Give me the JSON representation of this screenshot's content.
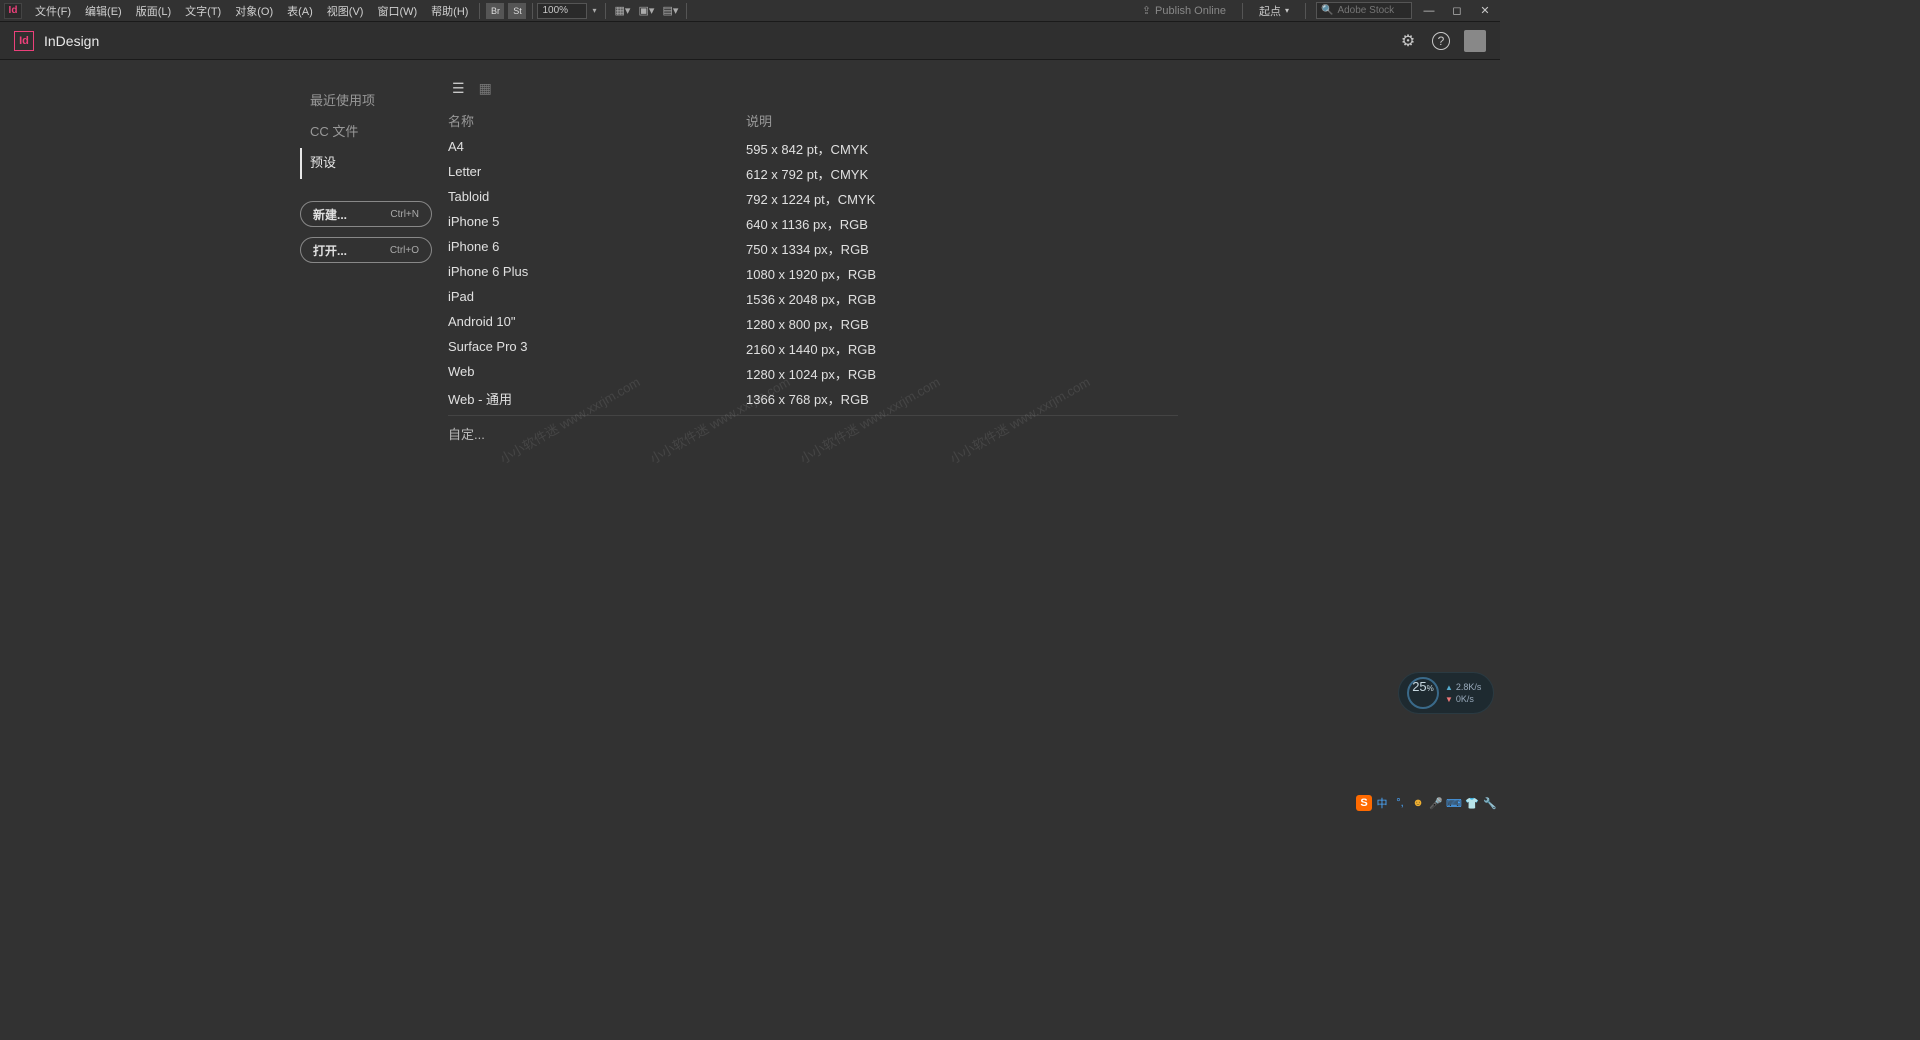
{
  "menubar": {
    "items": [
      "文件(F)",
      "编辑(E)",
      "版面(L)",
      "文字(T)",
      "对象(O)",
      "表(A)",
      "视图(V)",
      "窗口(W)",
      "帮助(H)"
    ],
    "br": "Br",
    "st": "St",
    "zoom": "100%",
    "publish": "Publish Online",
    "origin": "起点",
    "stock_placeholder": "Adobe Stock"
  },
  "titlebar": {
    "logo": "Id",
    "title": "InDesign"
  },
  "sidebar": {
    "tabs": [
      "最近使用项",
      "CC 文件",
      "预设"
    ],
    "active_index": 2,
    "buttons": [
      {
        "label": "新建...",
        "shortcut": "Ctrl+N"
      },
      {
        "label": "打开...",
        "shortcut": "Ctrl+O"
      }
    ]
  },
  "presets": {
    "header_name": "名称",
    "header_desc": "说明",
    "rows": [
      {
        "name": "A4",
        "desc": "595 x 842 pt，CMYK"
      },
      {
        "name": "Letter",
        "desc": "612 x 792 pt，CMYK"
      },
      {
        "name": "Tabloid",
        "desc": "792 x 1224 pt，CMYK"
      },
      {
        "name": "iPhone 5",
        "desc": "640 x 1136 px，RGB"
      },
      {
        "name": "iPhone 6",
        "desc": "750 x 1334 px，RGB"
      },
      {
        "name": "iPhone 6 Plus",
        "desc": "1080 x 1920 px，RGB"
      },
      {
        "name": "iPad",
        "desc": "1536 x 2048 px，RGB"
      },
      {
        "name": "Android 10\"",
        "desc": "1280 x 800 px，RGB"
      },
      {
        "name": "Surface Pro 3",
        "desc": "2160 x 1440 px，RGB"
      },
      {
        "name": "Web",
        "desc": "1280 x 1024 px，RGB"
      },
      {
        "name": "Web - 通用",
        "desc": "1366 x 768 px，RGB"
      }
    ],
    "custom": "自定..."
  },
  "watermark": "小小软件迷 www.xxrjm.com",
  "net_widget": {
    "percent": "25",
    "pct_suffix": "%",
    "up": "2.8K/s",
    "down": "0K/s"
  }
}
